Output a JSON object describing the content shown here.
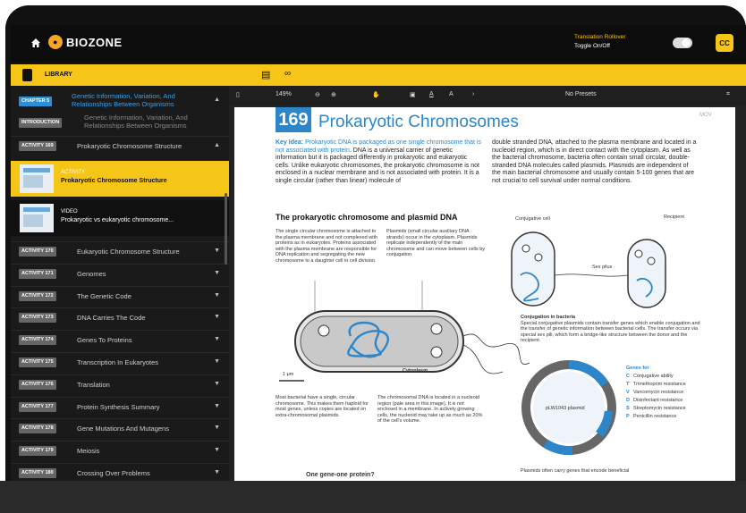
{
  "header": {
    "logo_text": "BIOZONE",
    "translation_title": "Translation Rollover",
    "translation_sub": "Toggle On/Off",
    "avatar_initials": "CC"
  },
  "library": {
    "label": "LIBRARY"
  },
  "sidebar": {
    "chapter": {
      "pill": "CHAPTER 5",
      "title_line1": "Genetic Information, Variation, And",
      "title_line2": "Relationships Between Organisms"
    },
    "introduction": {
      "pill": "INTRODUCTION",
      "title_line1": "Genetic Information, Variation, And",
      "title_line2": "Relationships Between Organisms"
    },
    "current": {
      "pill": "ACTIVITY 169",
      "title": "Prokaryotic Chromosome Structure"
    },
    "cards": [
      {
        "tag": "ACTIVITY",
        "title": "Prokaryotic Chromosome Structure"
      },
      {
        "tag": "VIDEO",
        "title": "Prokaryotic vs eukaryotic chromosome..."
      }
    ],
    "activities": [
      {
        "pill": "ACTIVITY 170",
        "title": "Eukaryotic Chromosome Structure"
      },
      {
        "pill": "ACTIVITY 171",
        "title": "Genomes"
      },
      {
        "pill": "ACTIVITY 172",
        "title": "The Genetic Code"
      },
      {
        "pill": "ACTIVITY 173",
        "title": "DNA Carries The Code"
      },
      {
        "pill": "ACTIVITY 174",
        "title": "Genes To Proteins"
      },
      {
        "pill": "ACTIVITY 175",
        "title": "Transcription In Eukaryotes"
      },
      {
        "pill": "ACTIVITY 176",
        "title": "Translation"
      },
      {
        "pill": "ACTIVITY 177",
        "title": "Protein Synthesis Summary"
      },
      {
        "pill": "ACTIVITY 178",
        "title": "Gene Mutations And Mutagens"
      },
      {
        "pill": "ACTIVITY 179",
        "title": "Meiosis"
      },
      {
        "pill": "ACTIVITY 180",
        "title": "Crossing Over Problems"
      }
    ]
  },
  "viewer": {
    "zoom": "149%",
    "presets": "No Presets",
    "page_number": "169",
    "page_title": "Prokaryotic Chromosomes",
    "page_corner": "MOV",
    "key_idea_label": "Key Idea:",
    "key_idea_text": "Prokaryotic DNA is packaged as one single chromosome that is not associated with protein.",
    "intro_text": "DNA is a universal carrier of genetic information but it is packaged differently in prokaryotic and eukaryotic cells. Unlike eukaryotic chromosomes, the prokaryotic chromosome is not enclosed in a nuclear membrane and is not associated with protein. It is a single circular (rather than linear) molecule of",
    "right_text": "double stranded DNA, attached to the plasma membrane and located in a nucleoid region, which is in direct contact with the cytoplasm. As well as the bacterial chromosome, bacteria often contain small circular, double-stranded DNA molecules called plasmids. Plasmids are independent of the main bacterial chromosome and usually contain 5-100 genes that are not crucial to cell survival under normal conditions.",
    "section_heading": "The prokaryotic chromosome and plasmid DNA",
    "col1_text": "The single circular chromosome is attached to the plasma membrane and not complexed with proteins as in eukaryotes. Proteins associated with the plasma membrane are responsible for DNA replication and segregating the new chromosome to a daughter cell in cell division.",
    "col2_text": "Plasmids (small circular auxiliary DNA strands) occur in the cytoplasm. Plasmids replicate independently of the main chromosome and can move between cells by conjugation.",
    "label_cytoplasm": "Cytoplasm",
    "label_scale": "1 μm",
    "bottom1_text": "Most bacterial have a single, circular chromosome. This makes them haploid for most genes, unless copies are located on extra-chromosomal plasmids.",
    "bottom2_text": "The chromosomal DNA is located in a nucleoid region (pale area in this image). It is not enclosed in a membrane. In actively growing cells, the nucleoid may take up as much as 20% of the cell's volume.",
    "label_conjugative": "Conjugative cell",
    "label_recipient": "Recipient",
    "label_sexpilus": "Sex pilus",
    "conj_heading": "Conjugation in bacteria",
    "conj_text": "Special conjugative plasmids contain transfer genes which enable conjugation and the transfer of genetic information between bacterial cells. The transfer occurs via special sex pili, which form a bridge-like structure between the donor and the recipient.",
    "plasmid_name": "pLW1043 plasmid",
    "genes_heading": "Genes for",
    "genes": [
      {
        "code": "C",
        "name": "Conjugative ability"
      },
      {
        "code": "T",
        "name": "Trimethoprim resistance"
      },
      {
        "code": "V",
        "name": "Vancomycin resistance"
      },
      {
        "code": "D",
        "name": "Disinfectant resistance"
      },
      {
        "code": "S",
        "name": "Streptomycin resistance"
      },
      {
        "code": "P",
        "name": "Penicillin resistance"
      }
    ],
    "plasmid_footer": "Plasmids often carry genes that encode beneficial",
    "subheading_bottom": "One gene-one protein?"
  }
}
